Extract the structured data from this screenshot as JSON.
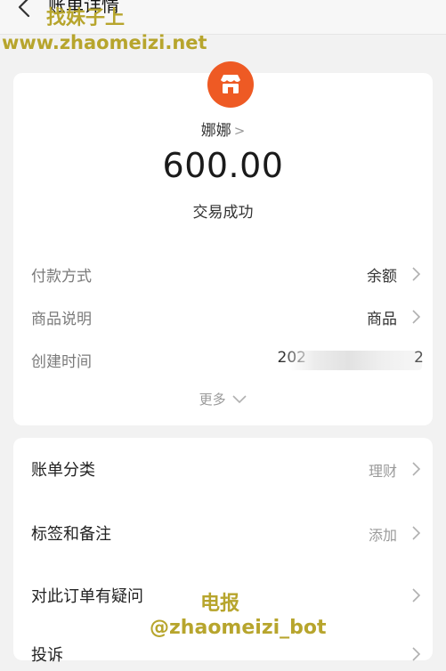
{
  "header": {
    "title": "账单详情"
  },
  "summary": {
    "payee": "娜娜",
    "amount": "600.00",
    "status": "交易成功"
  },
  "details": [
    {
      "label": "付款方式",
      "value": "余额"
    },
    {
      "label": "商品说明",
      "value": "商品"
    },
    {
      "label": "创建时间",
      "value": "202",
      "value_end": "2"
    }
  ],
  "more_label": "更多",
  "actions": [
    {
      "label": "账单分类",
      "value": "理财"
    },
    {
      "label": "标签和备注",
      "value": "添加"
    },
    {
      "label": "对此订单有疑问",
      "value": ""
    },
    {
      "label": "投诉",
      "value": ""
    }
  ],
  "watermark": {
    "line1": "找妹子上",
    "line2": "www.zhaomeizi.net",
    "line3": "电报",
    "line4": "@zhaomeizi_bot"
  },
  "colors": {
    "logo": "#ee5a24",
    "watermark": "#b7a52d"
  }
}
